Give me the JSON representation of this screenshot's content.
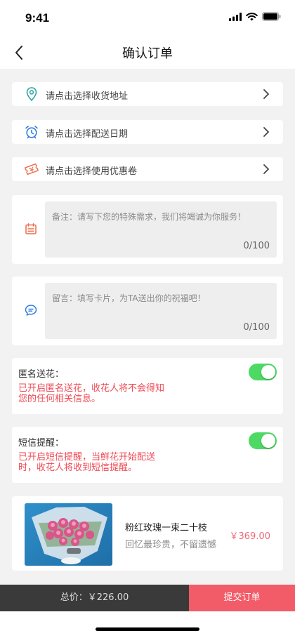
{
  "status": {
    "time": "9:41"
  },
  "header": {
    "title": "确认订单",
    "back_icon": "chevron-left-icon"
  },
  "rows": [
    {
      "label": "请点击选择收货地址",
      "icon": "location-pin-icon",
      "color": "#2aa7a0"
    },
    {
      "label": "请点击选择配送日期",
      "icon": "alarm-clock-icon",
      "color": "#2f7de1"
    },
    {
      "label": "请点击选择使用优惠卷",
      "icon": "coupon-icon",
      "color": "#ef6b4a"
    }
  ],
  "remark": {
    "placeholder": "备注：请写下您的特殊需求，我们将竭诚为你服务！",
    "count": "0/100",
    "icon": "calendar-icon",
    "color": "#ef6b4a"
  },
  "message": {
    "placeholder": "留言：填写卡片，为TA送出你的祝福吧！",
    "count": "0/100",
    "icon": "chat-bubble-icon",
    "color": "#2f7de1"
  },
  "anonymous": {
    "label": "匿名送花：",
    "description": "已开启匿名送花，收花人将不会得知您的任何相关信息。",
    "enabled": true
  },
  "sms": {
    "label": "短信提醒：",
    "description": "已开启短信提醒，当鲜花开始配送时，收花人将收到短信提醒。",
    "enabled": true
  },
  "product": {
    "name": "粉红玫瑰一束二十枝",
    "subtitle": "回忆最珍贵，不留遗憾",
    "price": "￥369.00"
  },
  "footer": {
    "total": "总价：￥226.00",
    "submit": "提交订单"
  },
  "colors": {
    "accent": "#f25b68",
    "switch_on": "#4cd964",
    "warning_text": "#ef4a55"
  }
}
